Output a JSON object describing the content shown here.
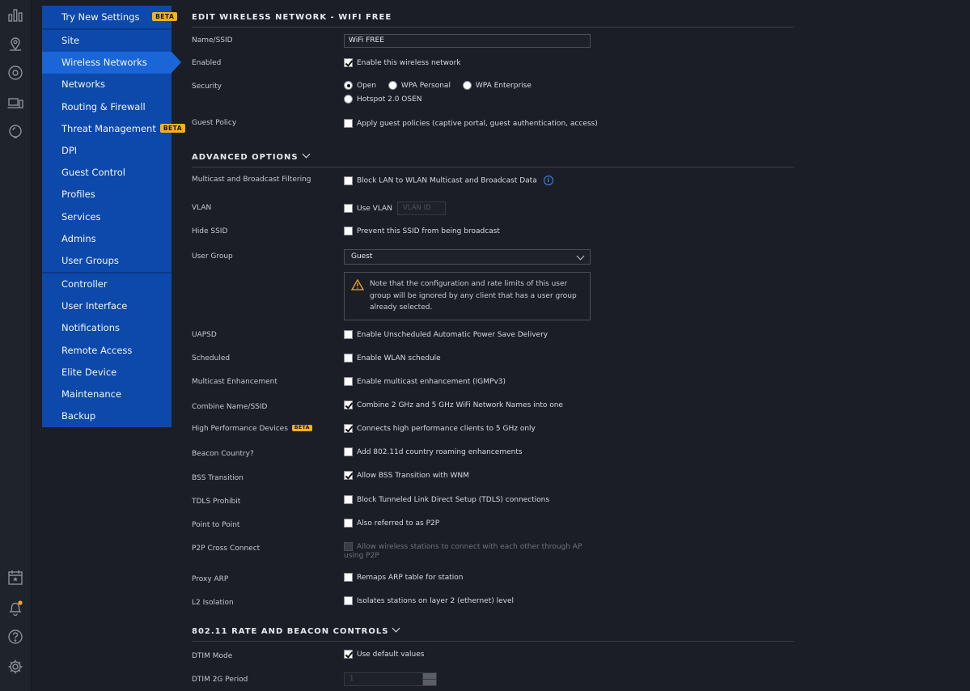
{
  "sidebar": {
    "try_new": "Try New Settings",
    "beta": "BETA",
    "group1": [
      "Site",
      "Wireless Networks",
      "Networks",
      "Routing & Firewall",
      "Threat Management",
      "DPI",
      "Guest Control",
      "Profiles",
      "Services",
      "Admins",
      "User Groups"
    ],
    "group2": [
      "Controller",
      "User Interface",
      "Notifications",
      "Remote Access",
      "Elite Device",
      "Maintenance",
      "Backup"
    ]
  },
  "header": {
    "title": "EDIT WIRELESS NETWORK - WIFI FREE"
  },
  "basic": {
    "name_label": "Name/SSID",
    "name_value": "WiFi FREE",
    "enabled_label": "Enabled",
    "enabled_text": "Enable this wireless network",
    "security_label": "Security",
    "sec_open": "Open",
    "sec_wpa_personal": "WPA Personal",
    "sec_wpa_enterprise": "WPA Enterprise",
    "sec_hotspot": "Hotspot 2.0 OSEN",
    "guest_label": "Guest Policy",
    "guest_text": "Apply guest policies (captive portal, guest authentication, access)"
  },
  "advanced": {
    "title": "ADVANCED OPTIONS",
    "multicast_label": "Multicast and Broadcast Filtering",
    "multicast_text": "Block LAN to WLAN Multicast and Broadcast Data",
    "info": "i",
    "vlan_label": "VLAN",
    "vlan_text": "Use VLAN",
    "vlan_placeholder": "VLAN ID",
    "hide_label": "Hide SSID",
    "hide_text": "Prevent this SSID from being broadcast",
    "usergroup_label": "User Group",
    "usergroup_value": "Guest",
    "warn_text": "Note that the configuration and rate limits of this user group will be ignored by any client that has a user group already selected.",
    "uapsd_label": "UAPSD",
    "uapsd_text": "Enable Unscheduled Automatic Power Save Delivery",
    "scheduled_label": "Scheduled",
    "scheduled_text": "Enable WLAN schedule",
    "mcast_enh_label": "Multicast Enhancement",
    "mcast_enh_text": "Enable multicast enhancement (IGMPv3)",
    "combine_label": "Combine Name/SSID",
    "combine_text": "Combine 2 GHz and 5 GHz WiFi Network Names into one",
    "hpd_label": "High Performance Devices",
    "hpd_text": "Connects high performance clients to 5 GHz only",
    "beacon_label": "Beacon Country?",
    "beacon_text": "Add 802.11d country roaming enhancements",
    "bss_label": "BSS Transition",
    "bss_text": "Allow BSS Transition with WNM",
    "tdls_label": "TDLS Prohibit",
    "tdls_text": "Block Tunneled Link Direct Setup (TDLS) connections",
    "p2p_label": "Point to Point",
    "p2p_text": "Also referred to as P2P",
    "p2pcc_label": "P2P Cross Connect",
    "p2pcc_text": "Allow wireless stations to connect with each other through AP using P2P",
    "proxy_label": "Proxy ARP",
    "proxy_text": "Remaps ARP table for station",
    "l2_label": "L2 Isolation",
    "l2_text": "Isolates stations on layer 2 (ethernet) level"
  },
  "rate": {
    "title": "802.11 RATE AND BEACON CONTROLS",
    "dtim_mode_label": "DTIM Mode",
    "dtim_mode_text": "Use default values",
    "dtim2g_label": "DTIM 2G Period",
    "dtim2g_value": "1"
  }
}
